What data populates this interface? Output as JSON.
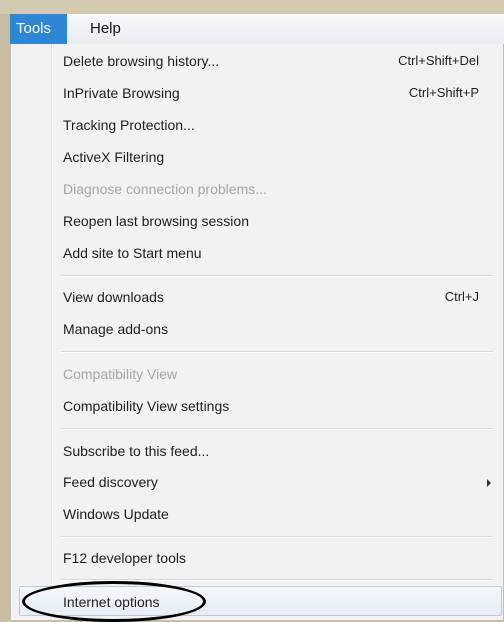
{
  "menubar": {
    "tools": "Tools",
    "help": "Help"
  },
  "menu": {
    "items": [
      {
        "label": "Delete browsing history...",
        "shortcut": "Ctrl+Shift+Del",
        "enabled": true
      },
      {
        "label": "InPrivate Browsing",
        "shortcut": "Ctrl+Shift+P",
        "enabled": true
      },
      {
        "label": "Tracking Protection...",
        "shortcut": "",
        "enabled": true
      },
      {
        "label": "ActiveX Filtering",
        "shortcut": "",
        "enabled": true
      },
      {
        "label": "Diagnose connection problems...",
        "shortcut": "",
        "enabled": false
      },
      {
        "label": "Reopen last browsing session",
        "shortcut": "",
        "enabled": true
      },
      {
        "label": "Add site to Start menu",
        "shortcut": "",
        "enabled": true
      },
      {
        "label": "View downloads",
        "shortcut": "Ctrl+J",
        "enabled": true
      },
      {
        "label": "Manage add-ons",
        "shortcut": "",
        "enabled": true
      },
      {
        "label": "Compatibility View",
        "shortcut": "",
        "enabled": false
      },
      {
        "label": "Compatibility View settings",
        "shortcut": "",
        "enabled": true
      },
      {
        "label": "Subscribe to this feed...",
        "shortcut": "",
        "enabled": true
      },
      {
        "label": "Feed discovery",
        "shortcut": "",
        "enabled": true,
        "submenu": true
      },
      {
        "label": "Windows Update",
        "shortcut": "",
        "enabled": true
      },
      {
        "label": "F12 developer tools",
        "shortcut": "",
        "enabled": true
      },
      {
        "label": "Internet options",
        "shortcut": "",
        "enabled": true,
        "highlighted": true
      }
    ]
  },
  "colors": {
    "menubar_active": "#2e87d6",
    "annotation": "#000000"
  }
}
